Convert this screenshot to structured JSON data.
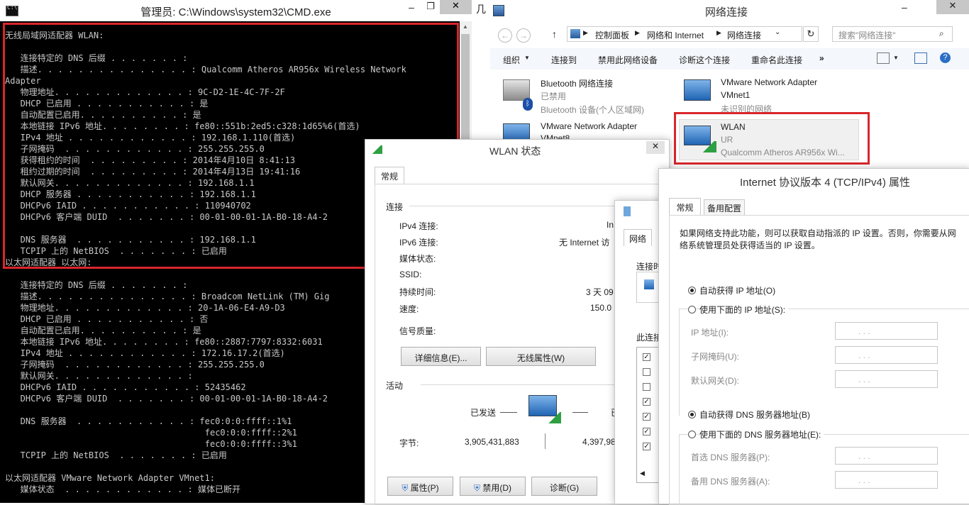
{
  "cmd": {
    "title": "管理员: C:\\Windows\\system32\\CMD.exe",
    "lines": [
      "无线局域网适配器 WLAN:",
      "",
      "   连接特定的 DNS 后缀 . . . . . . . :",
      "   描述. . . . . . . . . . . . . . . : Qualcomm Atheros AR956x Wireless Network",
      "Adapter",
      "   物理地址. . . . . . . . . . . . . : 9C-D2-1E-4C-7F-2F",
      "   DHCP 已启用 . . . . . . . . . . . : 是",
      "   自动配置已启用. . . . . . . . . . : 是",
      "   本地链接 IPv6 地址. . . . . . . . : fe80::551b:2ed5:c328:1d65%6(首选)",
      "   IPv4 地址 . . . . . . . . . . . . : 192.168.1.110(首选)",
      "   子网掩码  . . . . . . . . . . . . : 255.255.255.0",
      "   获得租约的时间  . . . . . . . . . : 2014年4月10日 8:41:13",
      "   租约过期的时间  . . . . . . . . . : 2014年4月13日 19:41:16",
      "   默认网关. . . . . . . . . . . . . : 192.168.1.1",
      "   DHCP 服务器 . . . . . . . . . . . : 192.168.1.1",
      "   DHCPv6 IAID . . . . . . . . . . . : 110940702",
      "   DHCPv6 客户端 DUID  . . . . . . . : 00-01-00-01-1A-B0-18-A4-2",
      "",
      "   DNS 服务器  . . . . . . . . . . . : 192.168.1.1",
      "   TCPIP 上的 NetBIOS  . . . . . . . : 已启用",
      "以太网适配器 以太网:",
      "",
      "   连接特定的 DNS 后缀 . . . . . . . :",
      "   描述. . . . . . . . . . . . . . . : Broadcom NetLink (TM) Gig",
      "   物理地址. . . . . . . . . . . . . : 20-1A-06-E4-A9-D3",
      "   DHCP 已启用 . . . . . . . . . . . : 否",
      "   自动配置已启用. . . . . . . . . . : 是",
      "   本地链接 IPv6 地址. . . . . . . . : fe80::2887:7797:8332:6031",
      "   IPv4 地址 . . . . . . . . . . . . : 172.16.17.2(首选)",
      "   子网掩码  . . . . . . . . . . . . : 255.255.255.0",
      "   默认网关. . . . . . . . . . . . . :",
      "   DHCPv6 IAID . . . . . . . . . . . : 52435462",
      "   DHCPv6 客户端 DUID  . . . . . . . : 00-01-00-01-1A-B0-18-A4-2",
      "",
      "   DNS 服务器  . . . . . . . . . . . : fec0:0:0:ffff::1%1",
      "                                       fec0:0:0:ffff::2%1",
      "                                       fec0:0:0:ffff::3%1",
      "   TCPIP 上的 NetBIOS  . . . . . . . : 已启用",
      "",
      "以太网适配器 VMware Network Adapter VMnet1:",
      "   媒体状态  . . . . . . . . . . . . : 媒体已断开"
    ]
  },
  "netwin": {
    "title": "网络连接",
    "left_sliver": "几",
    "breadcrumb": [
      "控制面板",
      "网络和 Internet",
      "网络连接"
    ],
    "search_placeholder": "搜索\"网络连接\"",
    "toolbar": [
      "组织",
      "连接到",
      "禁用此网络设备",
      "诊断这个连接",
      "重命名此连接",
      "»"
    ],
    "items": [
      {
        "name": "Bluetooth 网络连接",
        "line2": "已禁用",
        "line3": "Bluetooth 设备(个人区域网)"
      },
      {
        "name": "VMware Network Adapter",
        "line2": "VMnet1",
        "line3": "未识别的网络"
      },
      {
        "name": "VMware Network Adapter",
        "line2": "VMnet8",
        "line3": ""
      },
      {
        "name": "WLAN",
        "line2": "UR",
        "line3": "Qualcomm Atheros AR956x Wi..."
      }
    ]
  },
  "wlan": {
    "title": "WLAN 状态",
    "tab": "常规",
    "group_connect": "连接",
    "rows": [
      {
        "label": "IPv4 连接:",
        "value": "In"
      },
      {
        "label": "IPv6 连接:",
        "value": "无 Internet 访"
      },
      {
        "label": "媒体状态:",
        "value": ""
      },
      {
        "label": "SSID:",
        "value": ""
      },
      {
        "label": "持续时间:",
        "value": "3 天 09"
      },
      {
        "label": "速度:",
        "value": "150.0"
      }
    ],
    "signal_label": "信号质量:",
    "btn_details": "详细信息(E)...",
    "btn_wireless": "无线属性(W)",
    "group_activity": "活动",
    "sent": "已发送",
    "recv": "已",
    "bytes_label": "字节:",
    "bytes_sent": "3,905,431,883",
    "bytes_recv": "4,397,98",
    "btn_props": "属性(P)",
    "btn_disable": "禁用(D)",
    "btn_diag": "诊断(G)"
  },
  "props": {
    "tab": "网络",
    "connect_using": "连接时",
    "items_label": "此连接"
  },
  "ipv4": {
    "title": "Internet 协议版本 4 (TCP/IPv4) 属性",
    "tab_general": "常规",
    "tab_alt": "备用配置",
    "desc": "如果网络支持此功能，则可以获取自动指派的 IP 设置。否则，你需要从网络系统管理员处获得适当的 IP 设置。",
    "auto_ip": "自动获得 IP 地址(O)",
    "manual_ip": "使用下面的 IP 地址(S):",
    "ip_label": "IP 地址(I):",
    "mask_label": "子网掩码(U):",
    "gw_label": "默认网关(D):",
    "auto_dns": "自动获得 DNS 服务器地址(B)",
    "manual_dns": "使用下面的 DNS 服务器地址(E):",
    "dns1_label": "首选 DNS 服务器(P):",
    "dns2_label": "备用 DNS 服务器(A):",
    "ip_dots": ".      .      ."
  }
}
